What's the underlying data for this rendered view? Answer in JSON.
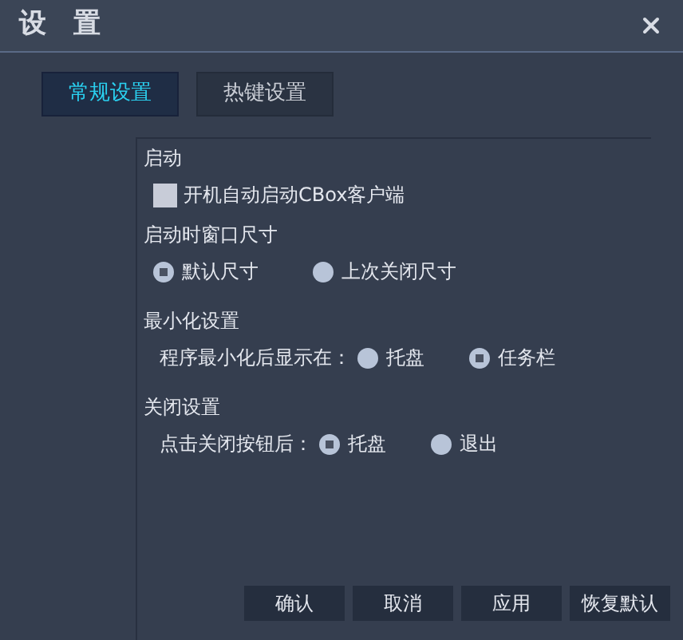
{
  "window": {
    "title": "设　置"
  },
  "tabs": [
    {
      "label": "常规设置",
      "selected": true
    },
    {
      "label": "热键设置",
      "selected": false
    }
  ],
  "sections": [
    {
      "title": "启动",
      "options": [
        {
          "kind": "checkbox",
          "label": "开机自动启动CBox客户端",
          "checked": false
        }
      ]
    },
    {
      "title": "启动时窗口尺寸",
      "options": [
        {
          "kind": "radio",
          "label": "默认尺寸",
          "selected": true
        },
        {
          "kind": "radio",
          "label": "上次关闭尺寸",
          "selected": false
        }
      ]
    },
    {
      "title": "最小化设置",
      "prompt": "程序最小化后显示在：",
      "options": [
        {
          "kind": "radio",
          "label": "托盘",
          "selected": false
        },
        {
          "kind": "radio",
          "label": "任务栏",
          "selected": true
        }
      ]
    },
    {
      "title": "关闭设置",
      "prompt": "点击关闭按钮后：",
      "options": [
        {
          "kind": "radio",
          "label": "托盘",
          "selected": true
        },
        {
          "kind": "radio",
          "label": "退出",
          "selected": false
        }
      ]
    }
  ],
  "buttons": [
    "确认",
    "取消",
    "应用",
    "恢复默认"
  ]
}
